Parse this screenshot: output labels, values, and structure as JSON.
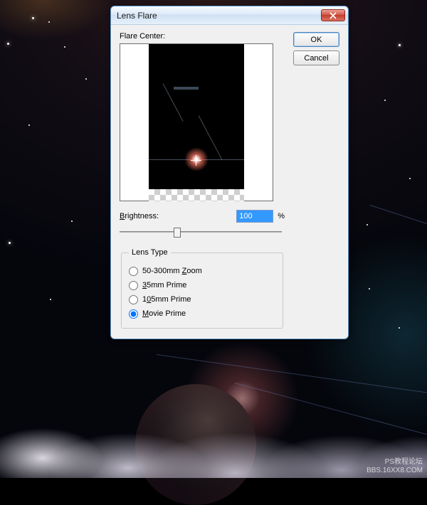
{
  "dialog": {
    "title": "Lens Flare",
    "ok_label": "OK",
    "cancel_label": "Cancel",
    "flare_center_label": "Flare Center:",
    "brightness_label": "Brightness:",
    "brightness_value": "100",
    "brightness_unit": "%",
    "lens_type_legend": "Lens Type",
    "lens_options": [
      {
        "label": "50-300mm Zoom",
        "checked": false
      },
      {
        "label": "35mm Prime",
        "checked": false
      },
      {
        "label": "105mm Prime",
        "checked": false
      },
      {
        "label": "Movie Prime",
        "checked": true
      }
    ]
  },
  "watermark": {
    "line1": "PS教程论坛",
    "line2": "BBS.16XX8.COM"
  }
}
